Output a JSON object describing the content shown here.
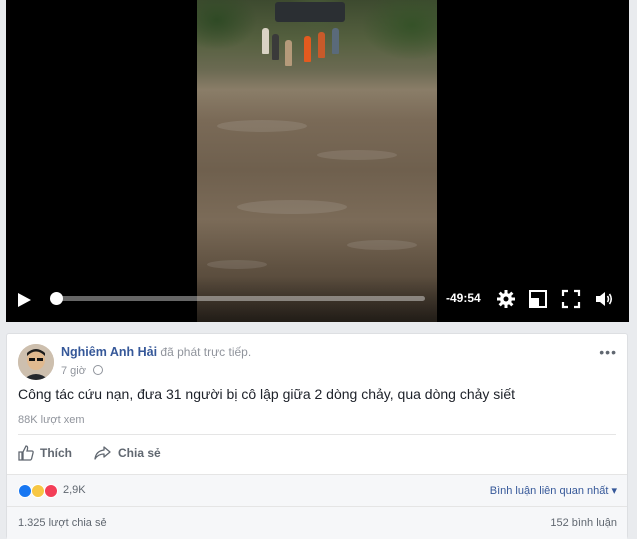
{
  "video": {
    "time_remaining": "-49:54",
    "progress_fraction": 0.01
  },
  "post": {
    "author": "Nghiêm Anh Hải",
    "action_text": "đã phát trực tiếp.",
    "time": "7 giờ",
    "text": "Công tác cứu nạn, đưa 31 người bị cô lập giữa 2 dòng chảy, qua dòng chảy siết",
    "views": "88K lượt xem",
    "more_icon": "•••"
  },
  "actions": {
    "like_label": "Thích",
    "share_label": "Chia sẻ"
  },
  "reactions": {
    "count": "2,9K",
    "sort_label": "Bình luận liên quan nhất",
    "colors": {
      "like": "#1877f2",
      "sad": "#f7c744",
      "love": "#f33e58"
    }
  },
  "footer": {
    "shares": "1.325 lượt chia sẻ",
    "comments": "152 bình luận"
  },
  "icons": {
    "play": "play-icon",
    "settings": "gear-icon",
    "pip": "picture-in-picture-icon",
    "fullscreen": "fullscreen-icon",
    "volume": "volume-icon",
    "like": "thumbs-up-icon",
    "share": "share-arrow-icon",
    "privacy": "globe-icon"
  }
}
